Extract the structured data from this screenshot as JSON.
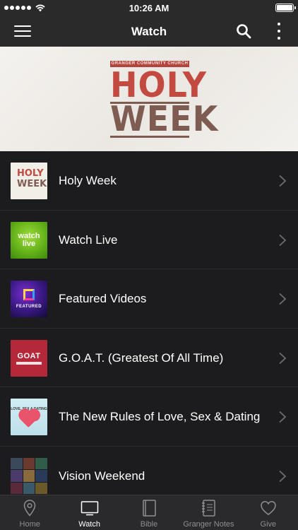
{
  "status_bar": {
    "time": "10:26 AM",
    "signal_bars": 5,
    "battery_level": 1.0
  },
  "nav": {
    "title": "Watch",
    "menu_icon": "hamburger-menu-icon",
    "search_icon": "search-icon",
    "more_icon": "more-vertical-icon"
  },
  "hero": {
    "subtitle": "GRANGER COMMUNITY CHURCH",
    "line1": "HOLY",
    "line2": "WEEK"
  },
  "list": {
    "items": [
      {
        "label": "Holy Week",
        "thumb_text": [
          "HOLY",
          "WEEK"
        ]
      },
      {
        "label": "Watch Live",
        "thumb_text": [
          "watch",
          "live"
        ]
      },
      {
        "label": "Featured Videos",
        "thumb_text": [
          "FEATURED"
        ]
      },
      {
        "label": "G.O.A.T. (Greatest Of All Time)",
        "thumb_text": [
          "GOAT"
        ]
      },
      {
        "label": "The New Rules of Love, Sex & Dating",
        "thumb_text": [
          "LOVE, SEX & DATING"
        ]
      },
      {
        "label": "Vision Weekend"
      }
    ]
  },
  "tab_bar": {
    "tabs": [
      {
        "label": "Home",
        "icon": "map-pin-icon",
        "active": false
      },
      {
        "label": "Watch",
        "icon": "tv-icon",
        "active": true
      },
      {
        "label": "Bible",
        "icon": "bible-book-icon",
        "active": false
      },
      {
        "label": "Granger Notes",
        "icon": "notebook-icon",
        "active": false
      },
      {
        "label": "Give",
        "icon": "heart-icon",
        "active": false
      }
    ]
  },
  "colors": {
    "bar_background": "#2a2a2a",
    "list_background": "#1c1c1e",
    "holy_red": "#c24a40",
    "week_brown": "#7e5c52",
    "tab_inactive": "#8e8e93",
    "tab_active": "#ffffff"
  }
}
